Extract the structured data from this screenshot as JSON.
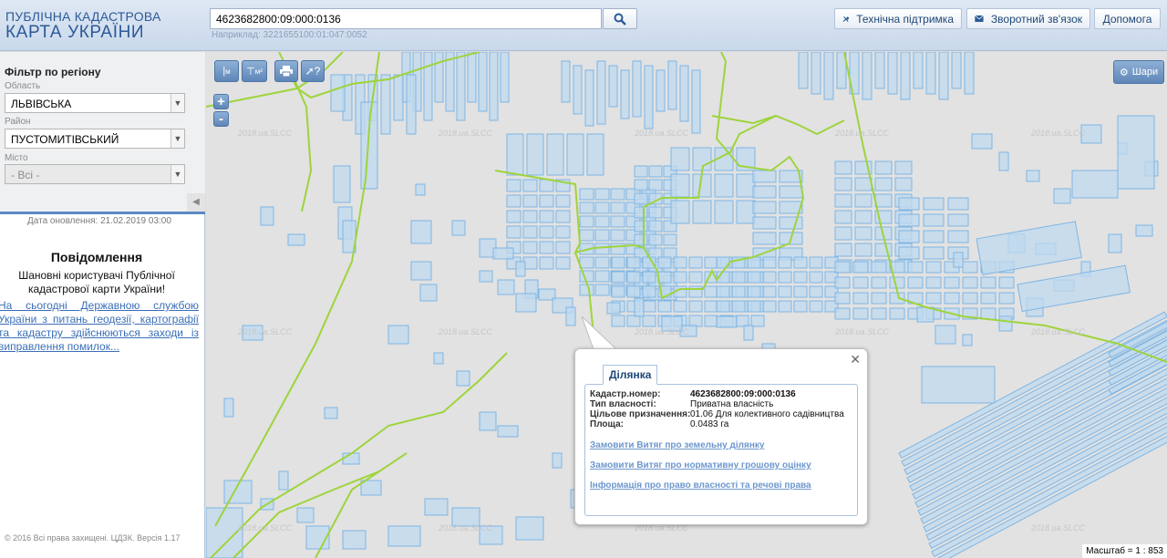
{
  "header": {
    "logo_line1": "ПУБЛІЧНА КАДАСТРОВА",
    "logo_line2": "КАРТА УКРАЇНИ",
    "search_value": "4623682800:09:000:0136",
    "example_text": "Наприклад: 3221655100:01:047:0052",
    "buttons": {
      "support": "Технічна підтримка",
      "feedback": "Зворотний зв'язок",
      "help": "Допомога"
    },
    "icons": {
      "search": "search-icon",
      "support": "tools-icon",
      "feedback": "envelope-icon"
    }
  },
  "sidebar": {
    "filter_title": "Фільтр по регіону",
    "oblast_label": "Область",
    "oblast_value": "ЛЬВІВСЬКА",
    "rayon_label": "Район",
    "rayon_value": "ПУСТОМИТІВСЬКИЙ",
    "city_label": "Місто",
    "city_value": "- Всі -",
    "update_text": "Дата оновлення: 21.02.2019 03:00",
    "notice_title": "Повідомлення",
    "notice_text": "Шановні користувачі Публічної кадастрової карти України!",
    "notice_link": "На сьогодні Державною службою України з питань геодезії, картографії та кадастру здійснюються заходи із виправлення помилок...",
    "copyright": "© 2016 Всі права захищені. ЦДЗК. Версія 1.17"
  },
  "map": {
    "tools": {
      "measure_m": "м",
      "measure_m2": "м²",
      "zoom_in": "+",
      "zoom_out": "-"
    },
    "layers_label": "Шари",
    "scale_text": "Масштаб = 1 : 853",
    "watermark": "2018.ua.SLCC",
    "colors": {
      "background": "#e2e2e2",
      "parcel_fill": "#bfd9ef",
      "parcel_stroke": "#7fb5e3",
      "boundary": "#9ed43c"
    }
  },
  "popup": {
    "tab": "Ділянка",
    "rows": [
      {
        "key": "Кадастр.номер:",
        "value": "4623682800:09:000:0136"
      },
      {
        "key": "Тип власності:",
        "value": "Приватна власність"
      },
      {
        "key": "Цільове призначення:",
        "value": "01.06 Для колективного садівництва"
      },
      {
        "key": "Площа:",
        "value": "0.0483 га"
      }
    ],
    "links": [
      "Замовити Витяг про земельну ділянку",
      "Замовити Витяг про нормативну грошову оцінку",
      "Інформація про право власності та речові права"
    ]
  }
}
